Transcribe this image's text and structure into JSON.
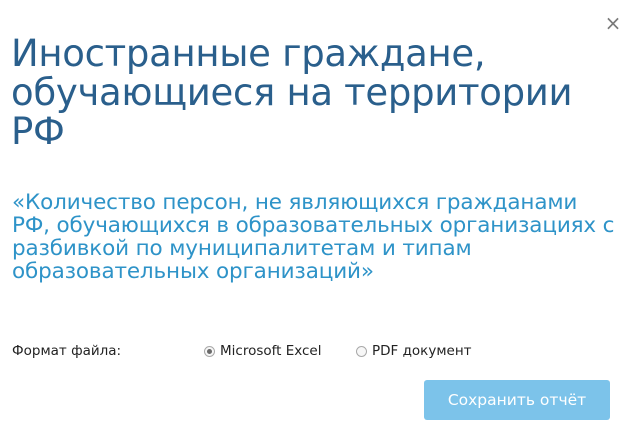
{
  "dialog": {
    "close_glyph": "×",
    "title": "Иностранные граждане, обучающиеся на территории РФ",
    "subtitle": "«Количество персон, не являющихся гражданами РФ, обучающихся в образовательных организациях с разбивкой по муниципалитетам и типам образовательных организаций»",
    "format": {
      "label": "Формат файла:",
      "options": [
        {
          "label": "Microsoft Excel",
          "selected": true
        },
        {
          "label": "PDF документ",
          "selected": false
        }
      ]
    },
    "save_label": "Сохранить отчёт"
  },
  "colors": {
    "title": "#2a5f8c",
    "subtitle": "#2e93c8",
    "button_bg": "#7cc3ea"
  }
}
